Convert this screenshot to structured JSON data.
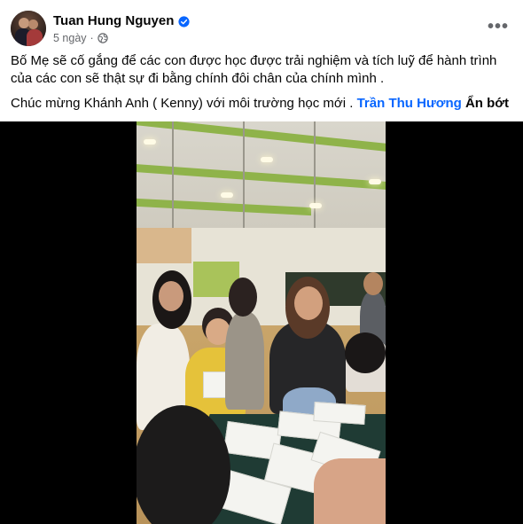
{
  "post": {
    "author_name": "Tuan Hung Nguyen",
    "verified": true,
    "time": "5 ngày",
    "separator": "·",
    "audience_icon": "globe-icon",
    "more_icon": "ellipsis-icon",
    "more_label": "•••"
  },
  "caption": {
    "line1": "Bố Mẹ sẽ cố gắng để các con được học được trải nghiệm và tích luỹ để hành trình của các con sẽ thật sự đi bằng chính đôi chân của chính mình .",
    "line2_text": "Chúc mừng Khánh Anh ( Kenny) với môi trường học mới . ",
    "mention": "Trần Thu Hương",
    "see_less": "Ẩn bớt"
  },
  "colors": {
    "link": "#0866ff",
    "secondary_text": "#65676b",
    "primary_text": "#050505",
    "verified_badge": "#0866ff",
    "video_background": "#000000"
  }
}
